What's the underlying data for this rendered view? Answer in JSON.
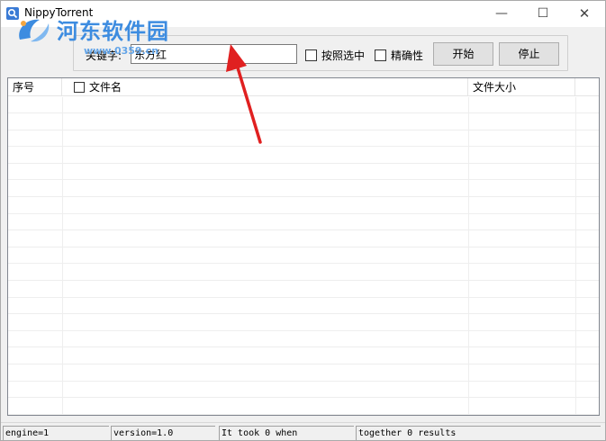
{
  "window": {
    "title": "NippyTorrent",
    "minimize_glyph": "—",
    "maximize_glyph": "☐",
    "close_glyph": "✕"
  },
  "watermark": {
    "title": "河东软件园",
    "url": "www.0359.cn",
    "color": "#3d8ce0"
  },
  "search": {
    "keyword_label": "关键字:",
    "keyword_value": "东方红",
    "option_select_label": "按照选中",
    "option_accuracy_label": "精确性",
    "start_label": "开始",
    "stop_label": "停止"
  },
  "table": {
    "columns": [
      "序号",
      "文件名",
      "文件大小"
    ],
    "rows": []
  },
  "statusbar": {
    "engine": "engine=1",
    "version": "version=1.0",
    "time": "It took 0 when",
    "results": "together 0 results"
  },
  "colors": {
    "arrow": "#e02020",
    "window_bg": "#f0f0f0",
    "list_bg": "#ffffff"
  },
  "icons": [
    "app-icon",
    "minimize-icon",
    "maximize-icon",
    "close-icon",
    "watermark-logo-icon",
    "annotation-arrow-icon"
  ]
}
